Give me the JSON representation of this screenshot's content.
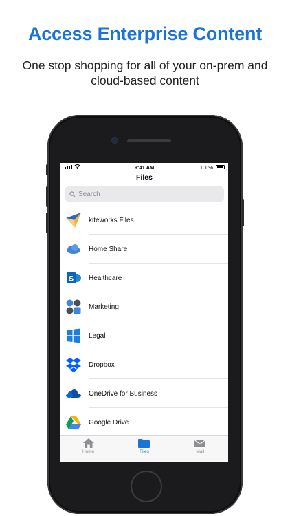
{
  "promo": {
    "headline": "Access Enterprise Content",
    "subline": "One stop shopping for all of your on-prem and cloud-based content"
  },
  "status_bar": {
    "time": "9:41 AM",
    "battery": "100%"
  },
  "screen": {
    "title": "Files",
    "search_placeholder": "Search"
  },
  "sources": [
    {
      "label": "kiteworks Files",
      "icon": "kiteworks-icon"
    },
    {
      "label": "Home Share",
      "icon": "cloud-share-icon"
    },
    {
      "label": "Healthcare",
      "icon": "sharepoint-icon"
    },
    {
      "label": "Marketing",
      "icon": "network-share-icon"
    },
    {
      "label": "Legal",
      "icon": "windows-icon"
    },
    {
      "label": "Dropbox",
      "icon": "dropbox-icon"
    },
    {
      "label": "OneDrive for Business",
      "icon": "onedrive-icon"
    },
    {
      "label": "Google Drive",
      "icon": "google-drive-icon"
    }
  ],
  "tabs": [
    {
      "label": "Home",
      "icon": "home-icon",
      "active": false
    },
    {
      "label": "Files",
      "icon": "folder-icon",
      "active": true
    },
    {
      "label": "Mail",
      "icon": "mail-icon",
      "active": false
    }
  ],
  "colors": {
    "accent": "#1a73d9",
    "sharepoint": "#0b64b8",
    "dropbox": "#0061fe",
    "onedrive": "#0a4fa8"
  }
}
